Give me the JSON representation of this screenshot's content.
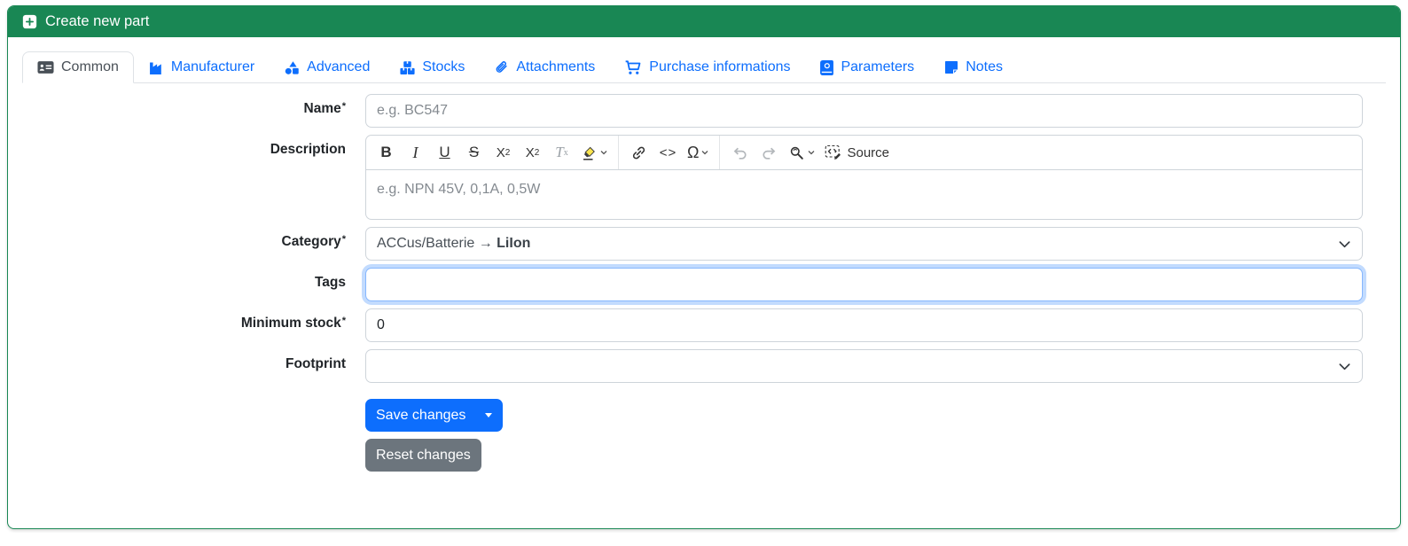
{
  "card": {
    "title": "Create new part"
  },
  "tabs": [
    {
      "label": "Common",
      "active": true
    },
    {
      "label": "Manufacturer"
    },
    {
      "label": "Advanced"
    },
    {
      "label": "Stocks"
    },
    {
      "label": "Attachments"
    },
    {
      "label": "Purchase informations"
    },
    {
      "label": "Parameters"
    },
    {
      "label": "Notes"
    }
  ],
  "form": {
    "required_marker": "*",
    "name": {
      "label": "Name",
      "placeholder": "e.g. BC547",
      "value": ""
    },
    "description": {
      "label": "Description",
      "placeholder": "e.g. NPN 45V, 0,1A, 0,5W"
    },
    "category": {
      "label": "Category",
      "value_prefix": "ACCus/Batterie → ",
      "value_highlight": "LiIon"
    },
    "tags": {
      "label": "Tags",
      "value": ""
    },
    "minimum_stock": {
      "label": "Minimum stock",
      "value": "0"
    },
    "footprint": {
      "label": "Footprint",
      "value": ""
    }
  },
  "editor_toolbar": {
    "bold": "B",
    "italic": "I",
    "underline": "U",
    "strikethrough": "S",
    "subscript_base": "X",
    "subscript_small": "2",
    "superscript_base": "X",
    "superscript_small": "2",
    "remove_format_base": "T",
    "remove_format_small": "x",
    "code": "<>",
    "special_characters": "Ω",
    "source_label": "Source"
  },
  "buttons": {
    "save": "Save changes",
    "reset": "Reset changes"
  },
  "colors": {
    "header_green": "#198754",
    "link_blue": "#0d6efd",
    "save_blue": "#0d6efd",
    "reset_gray": "#6c757d",
    "focus_ring": "#86b7fe"
  }
}
